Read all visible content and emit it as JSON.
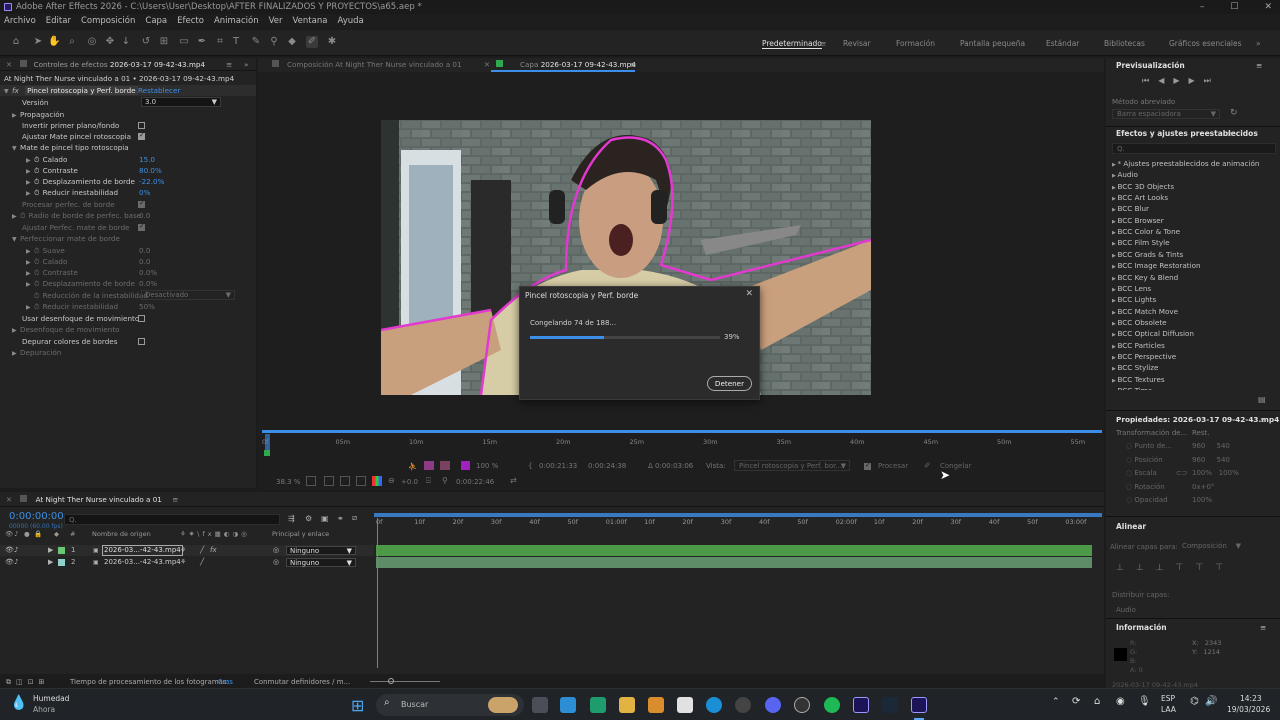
{
  "titlebar": {
    "title": "Adobe After Effects 2026 - C:\\Users\\User\\Desktop\\AFTER FINALIZADOS Y PROYECTOS\\a65.aep *",
    "min": "–",
    "max": "☐",
    "close": "✕"
  },
  "menu": [
    "Archivo",
    "Editar",
    "Composición",
    "Capa",
    "Efecto",
    "Animación",
    "Ver",
    "Ventana",
    "Ayuda"
  ],
  "workspaces": {
    "active": "Predeterminado",
    "items": [
      "Revisar",
      "Formación",
      "Pantalla pequeña",
      "Estándar",
      "Bibliotecas",
      "Gráficos esenciales"
    ]
  },
  "effects_panel": {
    "tab_prefix": "Controles de efectos",
    "tab_file": "2026-03-17 09-42-43.mp4",
    "layer": "At Night Ther Nurse vinculado a 01 • 2026-03-17 09-42-43.mp4",
    "fx_name": "Pincel rotoscopia y Perf. borde",
    "reset": "Restablecer",
    "version_label": "Versión",
    "version_value": "3.0",
    "propagacion": "Propagación",
    "invertir": "Invertir primer plano/fondo",
    "ajustar_mate": "Ajustar Mate pincel rotoscopia",
    "mate_pincel": "Mate de pincel tipo rotoscopia",
    "calado": "Calado",
    "calado_v": "15.0",
    "contraste": "Contraste",
    "contraste_v": "80.0%",
    "desplaz": "Desplazamiento de borde",
    "desplaz_v": "-22.0%",
    "reducir": "Reducir inestabilidad",
    "reducir_v": "0%",
    "procesar": "Procesar perfec. de borde",
    "radio": "Radio de borde de perfec. base",
    "radio_v": "0.0",
    "ajustar_perf": "Ajustar Perfec. mate de borde",
    "perfeccionar": "Perfeccionar mate de borde",
    "suave": "Suave",
    "suave_v": "0.0",
    "calado2": "Calado",
    "calado2_v": "0.0",
    "contraste2": "Contraste",
    "contraste2_v": "0.0%",
    "desplaz2": "Desplazamiento de borde",
    "desplaz2_v": "0.0%",
    "reduccion": "Reducción de la inestabilidad",
    "reduccion_v": "Desactivado",
    "reducir2": "Reducir inestabilidad",
    "reducir2_v": "50%",
    "usar_desenf": "Usar desenfoque de movimiento",
    "desenf": "Desenfoque de movimiento",
    "depurar": "Depurar colores de bordes",
    "depuracion": "Depuración"
  },
  "viewer": {
    "tab1": "Composición At Night Ther Nurse vinculado a 01",
    "tab2_prefix": "Capa",
    "tab2_file": "2026-03-17 09-42-43.mp4",
    "ruler": [
      "0f",
      "05m",
      "10m",
      "15m",
      "20m",
      "25m",
      "30m",
      "35m",
      "40m",
      "45m",
      "50m",
      "55m"
    ],
    "zoom": "100 %",
    "t_in": "0:00:21:33",
    "t_out": "0:00:24:38",
    "t_dur": "Δ 0:00:03:06",
    "vista_label": "Vista:",
    "vista_value": "Pincel rotoscopia y Perf. bor...",
    "procesar": "Procesar",
    "congelar": "Congelar",
    "zoom2": "38.3 %",
    "offset": "+0.0",
    "time": "0:00:22:46"
  },
  "dialog": {
    "title": "Pincel rotoscopia y Perf. borde",
    "status": "Congelando 74 de 188...",
    "progress": 0.39,
    "percent": "39%",
    "stop": "Detener"
  },
  "timeline": {
    "comp": "At Night Ther Nurse vinculado a 01",
    "timecode": "0:00:00:00",
    "fps": "00000 (60.00 fps)",
    "col_name": "Nombre de origen",
    "col_parent": "Principal y enlace",
    "col_num": "#",
    "ruler": [
      "0f",
      "10f",
      "20f",
      "30f",
      "40f",
      "50f",
      "01:00f",
      "10f",
      "20f",
      "30f",
      "40f",
      "50f",
      "02:00f",
      "10f",
      "20f",
      "30f",
      "40f",
      "50f",
      "03:00f"
    ],
    "layers": [
      {
        "num": "1",
        "name": "2026-03...-42-43.mp4",
        "parent": "Ninguno"
      },
      {
        "num": "2",
        "name": "2026-03...-42-43.mp4",
        "parent": "Ninguno"
      }
    ],
    "footer_label": "Tiempo de procesamiento de los fotogramas:",
    "footer_value": "0ms",
    "footer_toggle": "Conmutar definidores / m..."
  },
  "right": {
    "preview": "Previsualización",
    "metodo": "Método abreviado",
    "metodo_value": "Barra espaciadora",
    "effects_title": "Efectos y ajustes preestablecidos",
    "search_placeholder": "Q.",
    "effects": [
      "* Ajustes preestablecidos de animación",
      "Audio",
      "BCC 3D Objects",
      "BCC Art Looks",
      "BCC Blur",
      "BCC Browser",
      "BCC Color & Tone",
      "BCC Film Style",
      "BCC Grads & Tints",
      "BCC Image Restoration",
      "BCC Key & Blend",
      "BCC Lens",
      "BCC Lights",
      "BCC Match Move",
      "BCC Obsolete",
      "BCC Optical Diffusion",
      "BCC Particles",
      "BCC Perspective",
      "BCC Stylize",
      "BCC Textures",
      "BCC Time"
    ],
    "props_title": "Propiedades: 2026-03-17 09-42-43.mp4",
    "transform": "Transformación de...",
    "rest": "Rest.",
    "punto": "Punto de...",
    "punto_v1": "960",
    "punto_v2": "540",
    "posicion": "Posición",
    "posicion_v1": "960",
    "posicion_v2": "540",
    "escala": "Escala",
    "escala_v1": "100%",
    "escala_v2": "100%",
    "rotacion": "Rotación",
    "rotacion_v": "0x+0°",
    "opacidad": "Opacidad",
    "opacidad_v": "100%",
    "alinear": "Alinear",
    "alinear_a": "Alinear capas para:",
    "alinear_v": "Composición",
    "distribuir": "Distribuir capas:",
    "audio": "Audio",
    "info": "Información",
    "r": "R:",
    "g": "G:",
    "b": "B:",
    "a": "A:",
    "a_v": "0",
    "x": "X:",
    "x_v": "2343",
    "y": "Y:",
    "y_v": "1214",
    "bottom": "2026-03-17 09-42-43.mp4"
  },
  "taskbar": {
    "weather": "Humedad",
    "weather2": "Ahora",
    "search": "Buscar",
    "lang1": "ESP",
    "lang2": "LAA",
    "time": "14:23",
    "date": "19/03/2026"
  }
}
